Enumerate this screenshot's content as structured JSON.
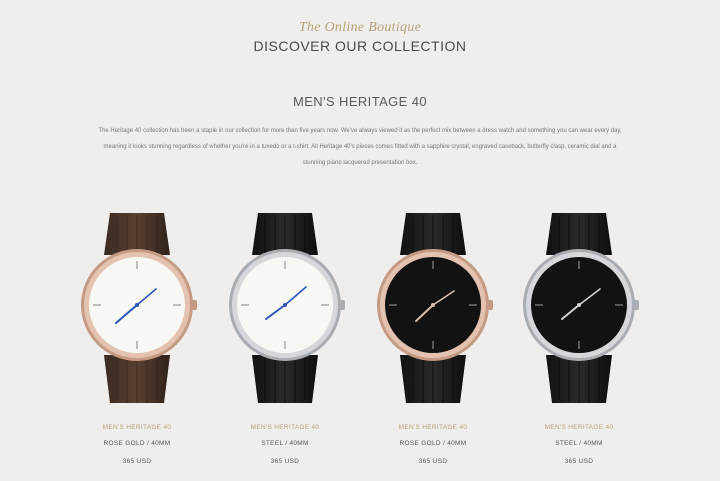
{
  "header": {
    "kicker": "The Online Boutique",
    "title": "DISCOVER OUR COLLECTION"
  },
  "collection": {
    "title": "MEN'S HERITAGE 40",
    "description": "The Heritage 40 collection has been a staple in our collection for more than five years now. We've always viewed it as the perfect mix between a dress watch and something you can wear every day, meaning it looks stunning regardless of whether you're in a tuxedo or a t-shirt. All Heritage 40's pieces comes fitted with a sapphire crystal, engraved caseback, butterfly clasp, ceramic dial and a stunning piano lacquered presentation box."
  },
  "products": [
    {
      "name": "MEN'S HERITAGE 40",
      "variant": "ROSE GOLD / 40MM",
      "price": "365 USD",
      "case": "rose-gold",
      "dial": "white",
      "strap": "brown"
    },
    {
      "name": "MEN'S HERITAGE 40",
      "variant": "STEEL / 40MM",
      "price": "365 USD",
      "case": "steel",
      "dial": "white",
      "strap": "black"
    },
    {
      "name": "MEN'S HERITAGE 40",
      "variant": "ROSE GOLD / 40MM",
      "price": "365 USD",
      "case": "rose-gold",
      "dial": "black",
      "strap": "black"
    },
    {
      "name": "MEN'S HERITAGE 40",
      "variant": "STEEL / 40MM",
      "price": "365 USD",
      "case": "steel",
      "dial": "black",
      "strap": "black"
    }
  ],
  "colors": {
    "background": "#efeeec",
    "accent": "#b8a27a",
    "rose_gold": "#d8b19a",
    "steel": "#c9cbcf",
    "blue_hands": "#2c55b8"
  }
}
